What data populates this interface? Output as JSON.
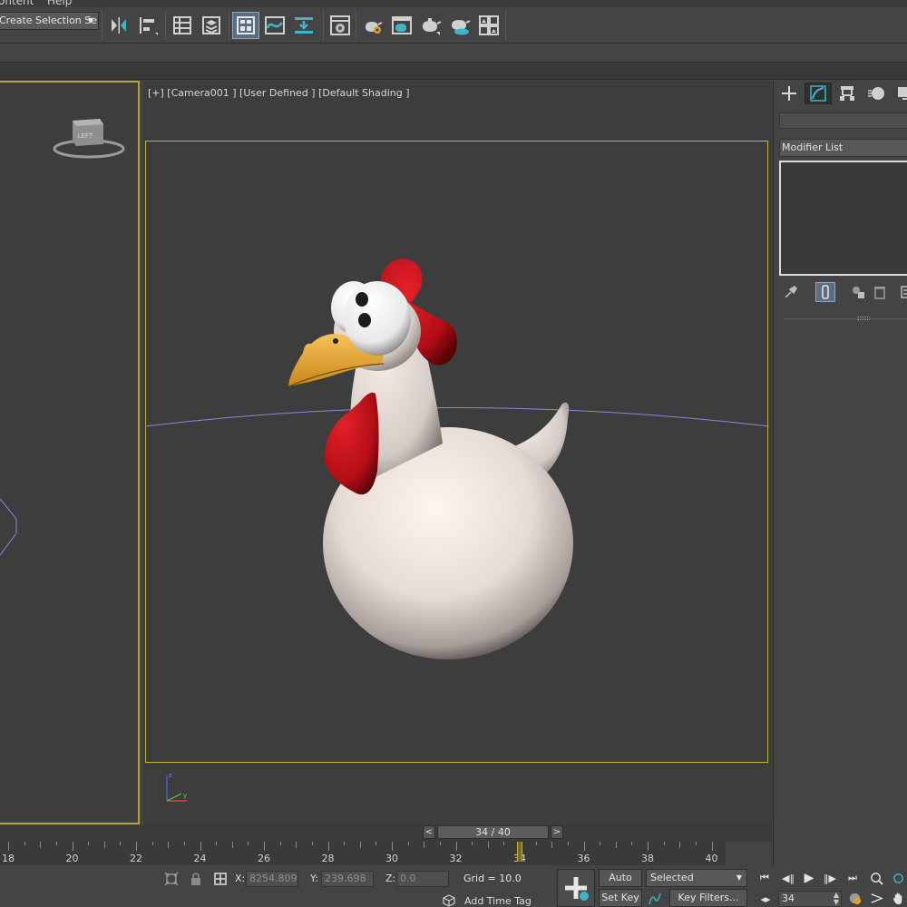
{
  "menu": {
    "items": [
      "ontent",
      "Help"
    ]
  },
  "toolbar": {
    "selection_set": "Create Selection Se"
  },
  "viewport": {
    "label": "[+] [Camera001 ] [User Defined ] [Default Shading ]",
    "viewcube_face": "LEFT"
  },
  "command_panel": {
    "modifier_list": "Modifier List"
  },
  "time_slider": {
    "position": "34 / 40",
    "prev": "<",
    "next": ">"
  },
  "trackbar": {
    "labels": [
      "18",
      "20",
      "22",
      "24",
      "26",
      "28",
      "30",
      "32",
      "34",
      "36",
      "38",
      "40"
    ],
    "current_frame": 34
  },
  "status": {
    "x_label": "X:",
    "x_value": "8254.809",
    "y_label": "Y:",
    "y_value": "239.698",
    "z_label": "Z:",
    "z_value": "0.0",
    "grid": "Grid = 10.0",
    "add_time_tag": "Add Time Tag"
  },
  "keys": {
    "auto_key": "Auto Key",
    "set_key": "Set Key",
    "selected": "Selected",
    "key_filters": "Key Filters...",
    "frame": "34"
  },
  "colors": {
    "accent_active": "#5b6e80",
    "viewport_border": "#c2b132",
    "bird_comb": "#c8101a",
    "bird_beak": "#e8aa3c"
  }
}
